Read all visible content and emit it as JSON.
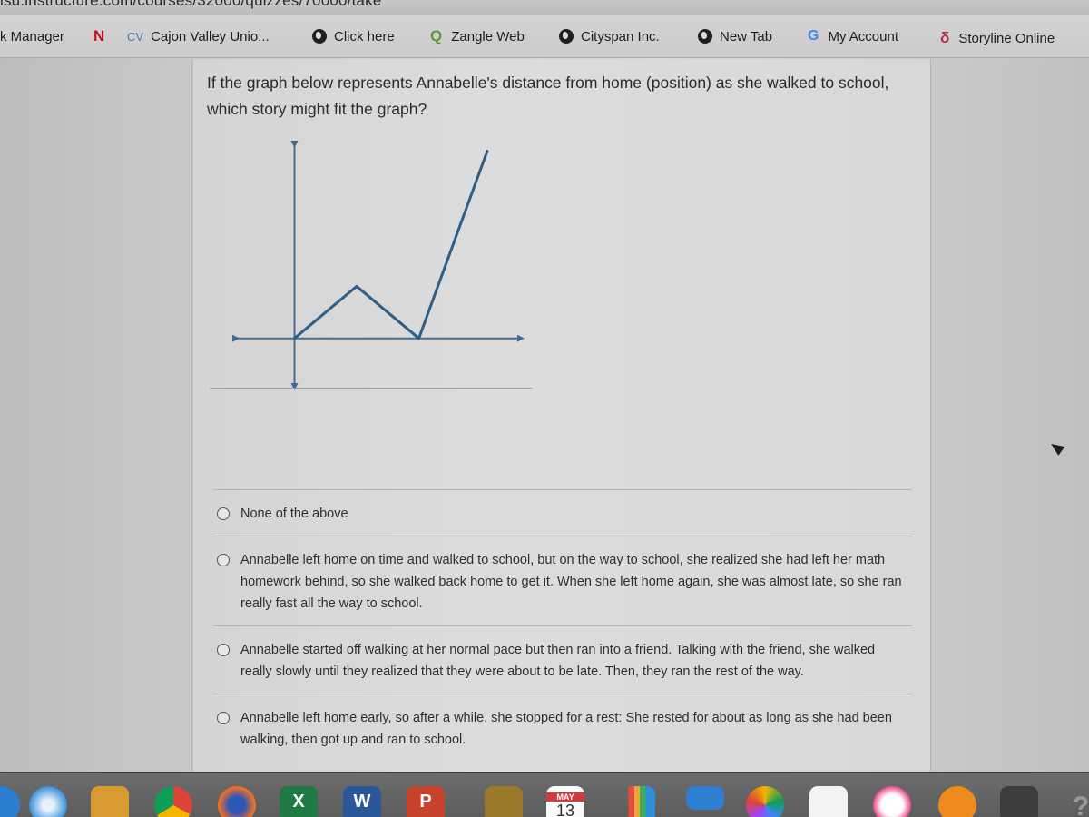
{
  "browser": {
    "url_fragment": "isu.instructure.com/courses/32000/quizzes/70000/take",
    "bookmarks": [
      {
        "label": "k Manager",
        "icon": "none"
      },
      {
        "label": "",
        "icon": "netflix-icon"
      },
      {
        "label": "Cajon Valley Unio...",
        "icon": "cv-icon"
      },
      {
        "label": "Click here",
        "icon": "globe-icon"
      },
      {
        "label": "Zangle Web",
        "icon": "zangle-icon"
      },
      {
        "label": "Cityspan Inc.",
        "icon": "globe-icon"
      },
      {
        "label": "New Tab",
        "icon": "globe-icon"
      },
      {
        "label": "My Account",
        "icon": "google-icon"
      },
      {
        "label": "Storyline Online",
        "icon": "storyline-icon"
      }
    ]
  },
  "quiz": {
    "question": "If the graph below represents Annabelle's distance from home (position) as she walked to school, which story might fit the graph?",
    "graph": {
      "description": "Position vs time: rises from origin, returns to zero, then rises steeply",
      "points": [
        [
          0,
          0
        ],
        [
          1,
          1
        ],
        [
          2,
          0
        ],
        [
          3.1,
          3.6
        ]
      ],
      "x_range": [
        -1,
        3.7
      ],
      "y_range": [
        -1,
        3.8
      ],
      "line_color": "#2e5f86",
      "axis_color": "#4a6e8f"
    },
    "answers": [
      {
        "label": "None of the above",
        "selected": false
      },
      {
        "label": "Annabelle left home on time and walked to school, but on the way to school, she realized she had left her math homework behind, so she walked back home to get it. When she left home again, she was almost late, so she ran really fast all the way to school.",
        "selected": false
      },
      {
        "label": "Annabelle started off walking at her normal pace but then ran into a friend. Talking with the friend, she walked really slowly until they realized that they were about to be late. Then, they ran the rest of the way.",
        "selected": false
      },
      {
        "label": "Annabelle left home early, so after a while, she stopped for a rest: She rested for about as long as she had been walking, then got up and ran to school.",
        "selected": false
      }
    ]
  },
  "dock": {
    "calendar": {
      "month": "MAY",
      "day": "13"
    },
    "apps": [
      "finder",
      "safari",
      "preview",
      "chrome",
      "firefox",
      "excel",
      "word",
      "powerpoint",
      "notes",
      "calendar",
      "numbers",
      "keynote",
      "photos",
      "reminders",
      "itunes",
      "ibooks",
      "system-preferences",
      "help"
    ]
  }
}
